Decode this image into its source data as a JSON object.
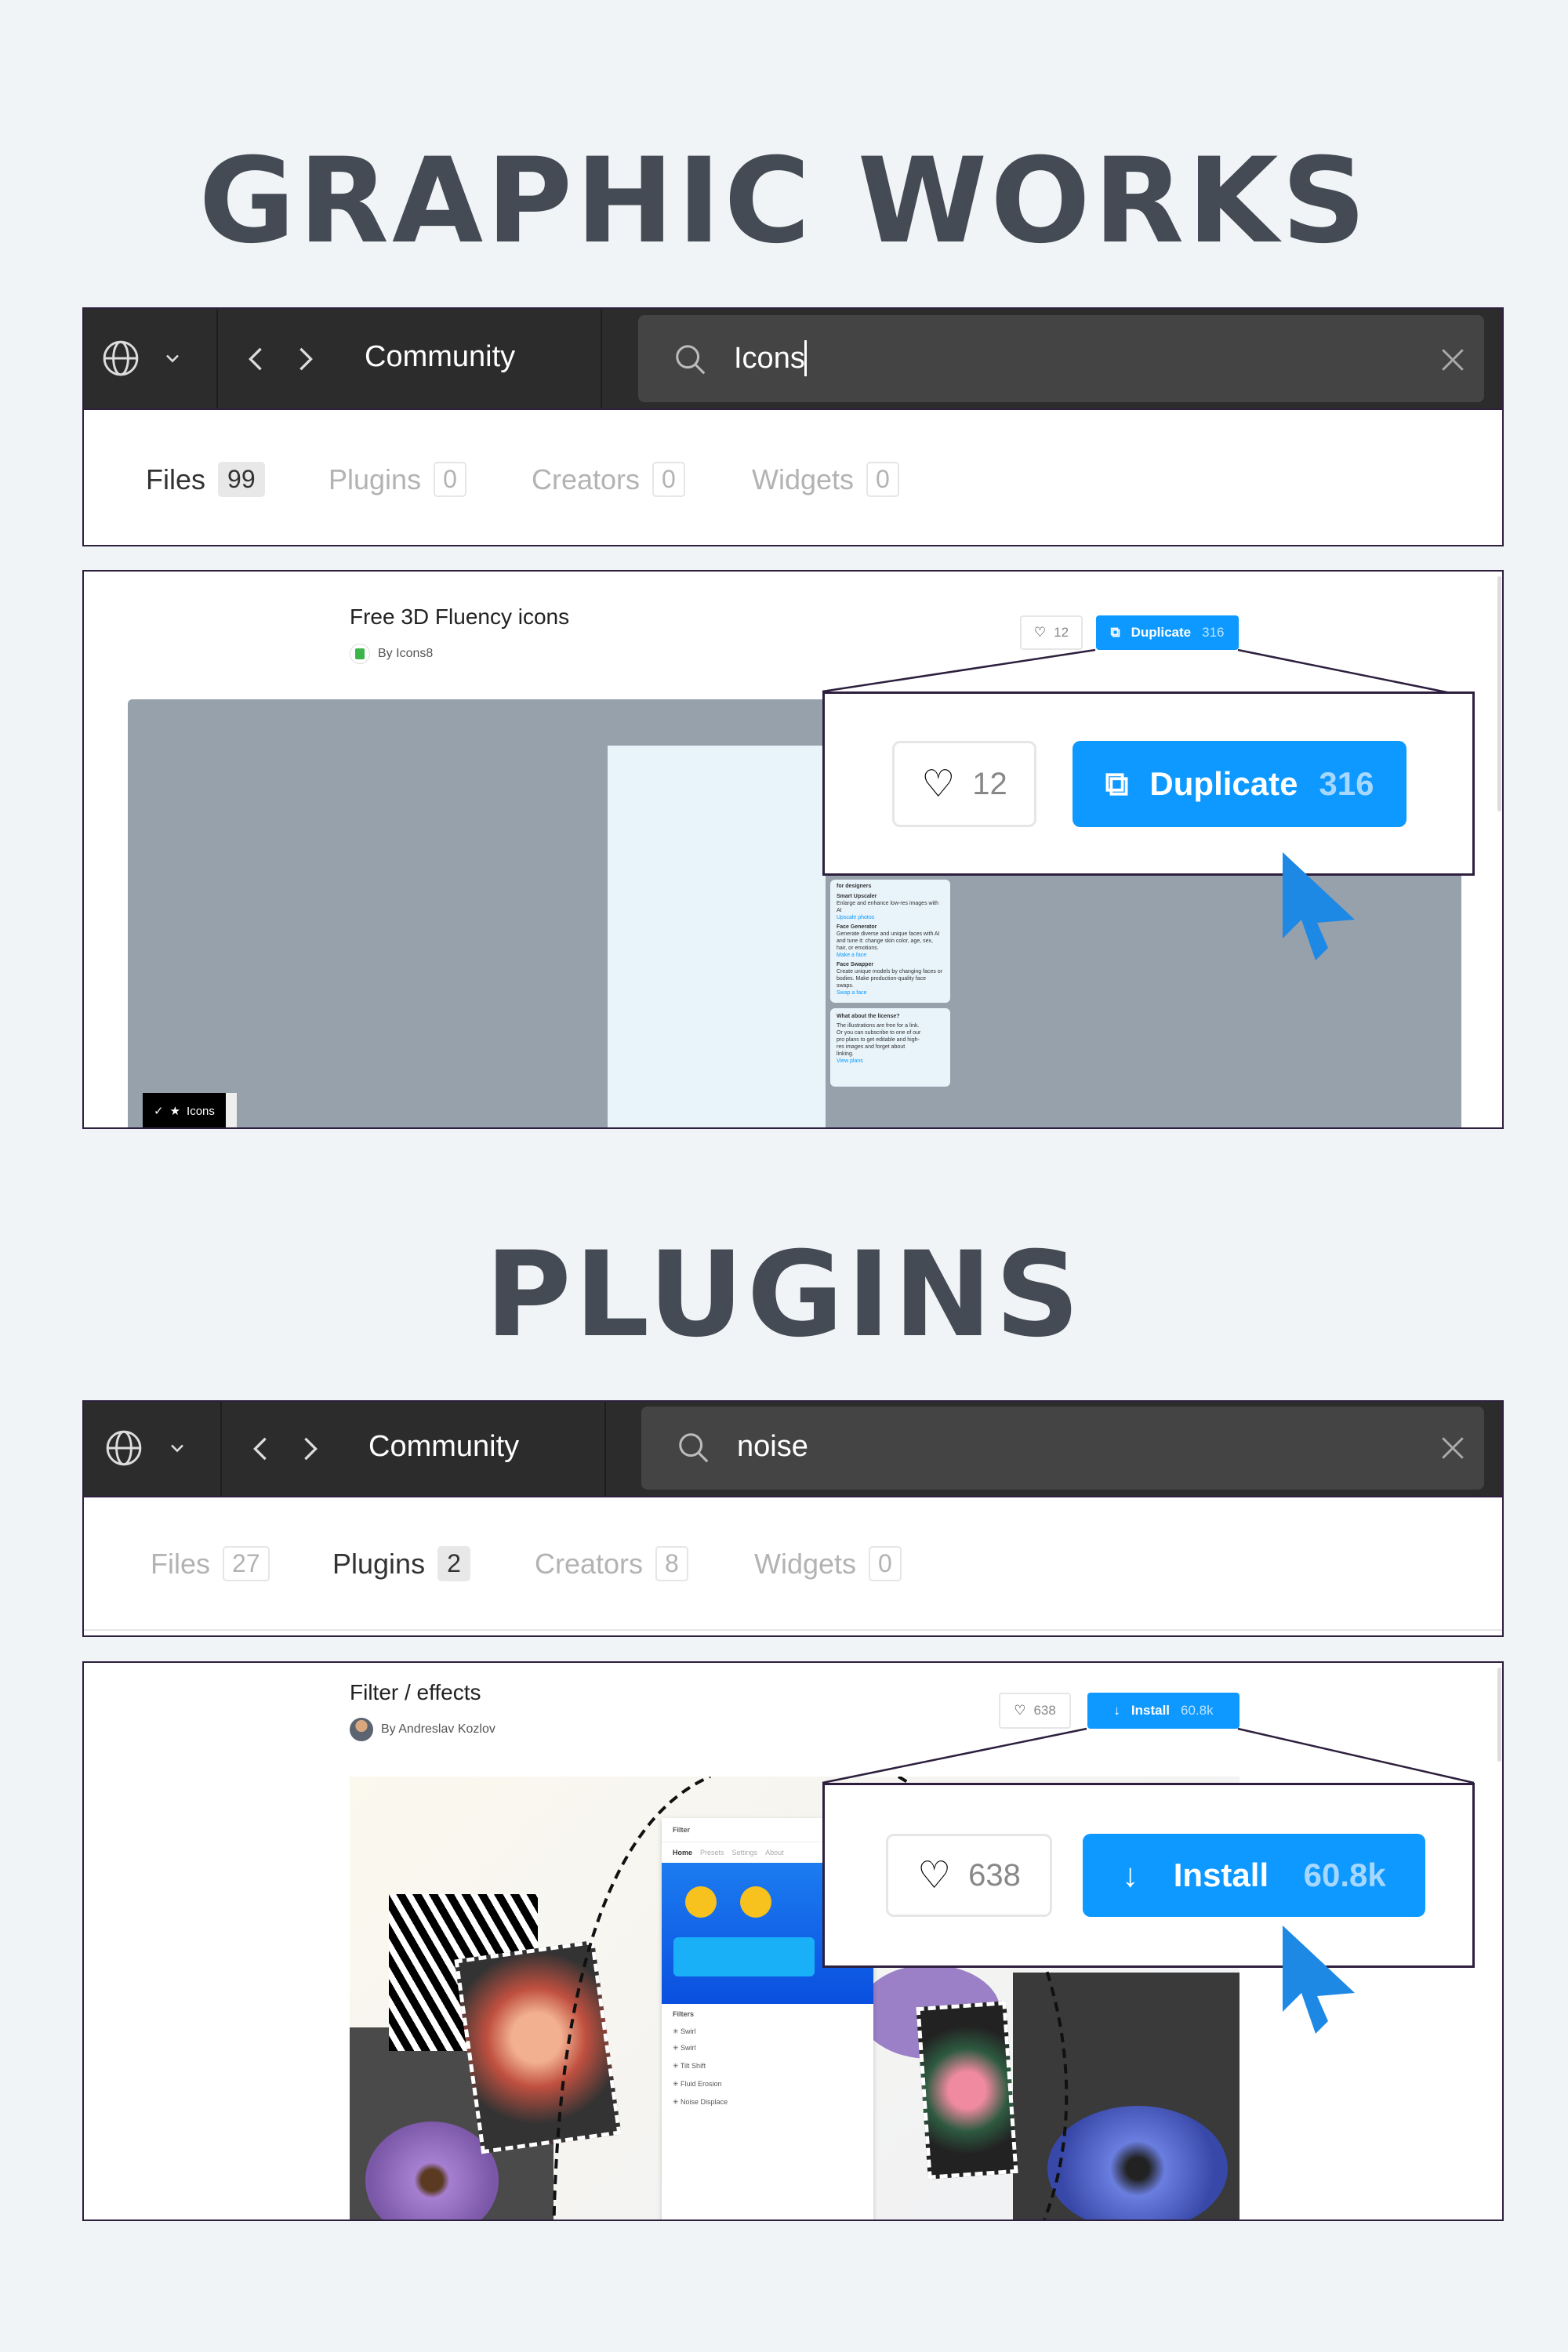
{
  "sections": [
    {
      "title": "GRAPHIC WORKS",
      "header": {
        "breadcrumb": "Community",
        "search_value": "Icons"
      },
      "tabs": [
        {
          "label": "Files",
          "count": "99",
          "active": true
        },
        {
          "label": "Plugins",
          "count": "0",
          "active": false
        },
        {
          "label": "Creators",
          "count": "0",
          "active": false
        },
        {
          "label": "Widgets",
          "count": "0",
          "active": false
        }
      ],
      "card": {
        "title": "Free 3D Fluency icons",
        "author": "By Icons8",
        "likes": "12",
        "action_label": "Duplicate",
        "action_count": "316",
        "preview": {
          "chip_label": "Icons",
          "panel_heading": "for designers",
          "items": [
            {
              "title": "Smart Upscaler",
              "text": "Enlarge and enhance low-res images with AI",
              "link": "Upscale photos"
            },
            {
              "title": "Face Generator",
              "text": "Generate diverse and unique faces with AI and tune it: change skin color, age, sex, hair, or emotions.",
              "link": "Make a face"
            },
            {
              "title": "Face Swapper",
              "text": "Create unique models by changing faces or bodies. Make production-quality face swaps.",
              "link": "Swap a face"
            }
          ],
          "license_heading": "What about the license?",
          "license_text": "The illustrations are free for a link.",
          "license_text2": "Or you can subscribe to one of our pro plans to get editable and high-res images and forget about linking.",
          "license_link": "View plans"
        }
      }
    },
    {
      "title": "PLUGINS",
      "header": {
        "breadcrumb": "Community",
        "search_value": "noise"
      },
      "tabs": [
        {
          "label": "Files",
          "count": "27",
          "active": false
        },
        {
          "label": "Plugins",
          "count": "2",
          "active": true
        },
        {
          "label": "Creators",
          "count": "8",
          "active": false
        },
        {
          "label": "Widgets",
          "count": "0",
          "active": false
        }
      ],
      "card": {
        "title": "Filter / effects",
        "author": "By Andreslav Kozlov",
        "likes": "638",
        "action_label": "Install",
        "action_count": "60.8k",
        "preview": {
          "panel_title": "Filter",
          "nav": [
            "Home",
            "Presets",
            "Settings",
            "About"
          ],
          "filters_heading": "Filters",
          "filters": [
            "Swirl",
            "Swirl",
            "Tilt Shift",
            "Fluid Erosion",
            "Noise Displace"
          ]
        }
      }
    }
  ],
  "colors": {
    "accent": "#0d99ff",
    "header_bg": "#2c2c2c",
    "search_bg": "#444444",
    "cursor": "#1e88e5",
    "title": "#454b54"
  }
}
